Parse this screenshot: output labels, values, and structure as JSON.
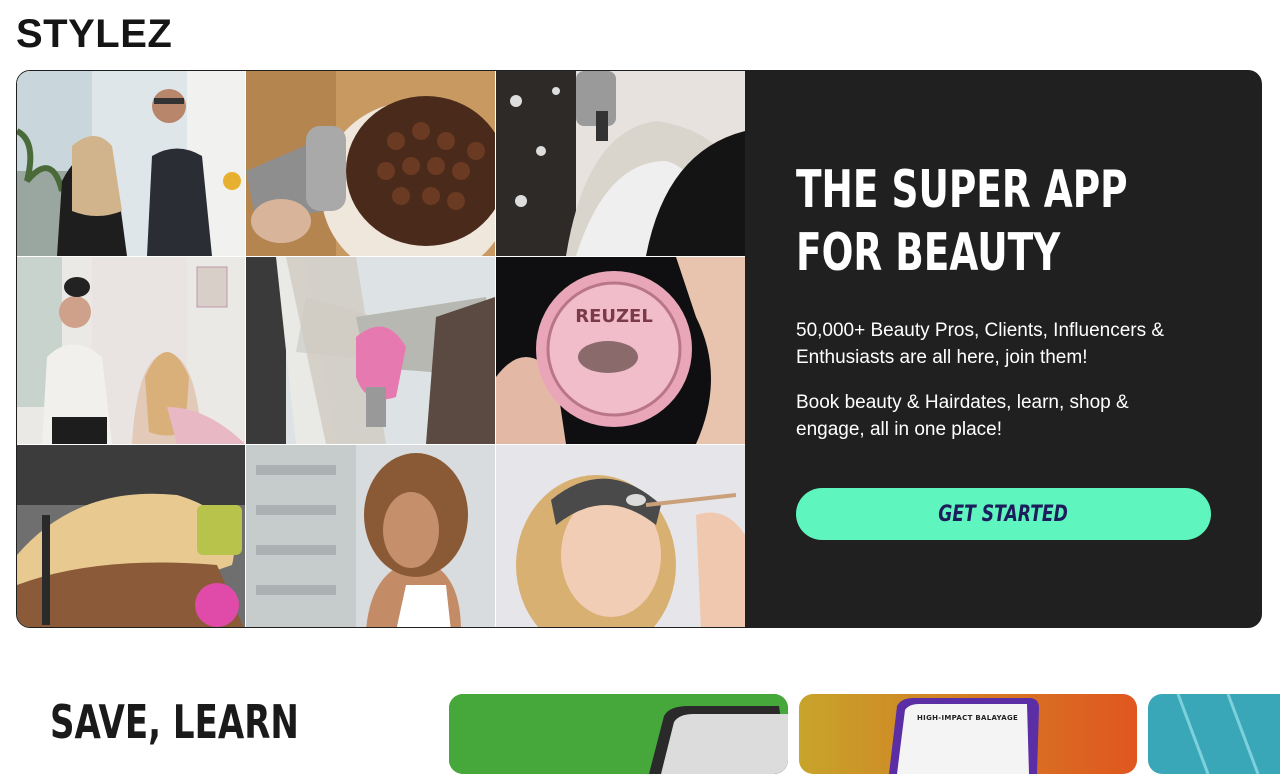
{
  "brand": {
    "logo": "STYLEZ"
  },
  "hero": {
    "headline_line1": "THE SUPER APP",
    "headline_line2": "FOR BEAUTY",
    "paragraph1": "50,000+ Beauty Pros, Clients, Influencers & Enthusiasts are all here, join them!",
    "paragraph2": "Book beauty & Hairdates, learn, shop & engage, all in one place!",
    "cta_label": "GET STARTED",
    "images": [
      {
        "name": "stylist-with-client-photo"
      },
      {
        "name": "hair-dryer-curls-photo"
      },
      {
        "name": "hair-color-application-photo"
      },
      {
        "name": "educator-demo-photo"
      },
      {
        "name": "foil-highlights-photo"
      },
      {
        "name": "reuzel-pomade-photo"
      },
      {
        "name": "blonde-updo-photo"
      },
      {
        "name": "curly-hair-model-photo"
      },
      {
        "name": "facial-treatment-photo"
      }
    ],
    "pomade_text": "REUZEL"
  },
  "section": {
    "title": "SAVE, LEARN",
    "card_label": "HIGH-IMPACT BALAYAGE"
  },
  "colors": {
    "accent": "#5ef6be",
    "panel": "#202020",
    "cta_text": "#1d1d5b"
  }
}
